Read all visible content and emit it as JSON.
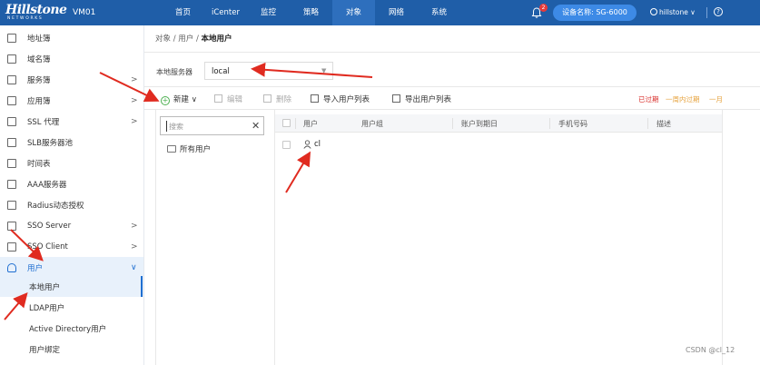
{
  "topbar": {
    "brand": "Hillstone",
    "brand_sub": "NETWORKS",
    "device": "VM01",
    "nav": [
      "首页",
      "iCenter",
      "监控",
      "策略",
      "对象",
      "网络",
      "系统"
    ],
    "active_nav": "对象",
    "notification_count": "2",
    "device_name_btn": "设备名称: SG-6000",
    "user": "hillstone",
    "user_caret": "∨",
    "help": "?"
  },
  "sidebar": {
    "items": [
      {
        "label": "地址簿",
        "chevron": ""
      },
      {
        "label": "域名簿",
        "chevron": ""
      },
      {
        "label": "服务簿",
        "chevron": ">"
      },
      {
        "label": "应用簿",
        "chevron": ">"
      },
      {
        "label": "SSL 代理",
        "chevron": ">"
      },
      {
        "label": "SLB服务器池",
        "chevron": ""
      },
      {
        "label": "时间表",
        "chevron": ""
      },
      {
        "label": "AAA服务器",
        "chevron": ""
      },
      {
        "label": "Radius动态授权",
        "chevron": ""
      },
      {
        "label": "SSO Server",
        "chevron": ">"
      },
      {
        "label": "SSO Client",
        "chevron": ">"
      },
      {
        "label": "用户",
        "chevron": "∨"
      }
    ],
    "sub_items": [
      "本地用户",
      "LDAP用户",
      "Active Directory用户",
      "用户绑定"
    ]
  },
  "breadcrumb": {
    "path": "对象 / 用户 / ",
    "current": "本地用户"
  },
  "server": {
    "label": "本地服务器",
    "value": "local",
    "caret": "▼"
  },
  "toolbar": {
    "new": "新建",
    "new_caret": "∨",
    "edit": "编辑",
    "delete": "删除",
    "import": "导入用户列表",
    "export": "导出用户列表",
    "expired": "已过期",
    "expire_week": "一周内过期",
    "expire_month": "一月"
  },
  "tree": {
    "search_placeholder": "搜索",
    "clear": "✕",
    "root": "所有用户"
  },
  "table": {
    "columns": [
      "用户",
      "用户组",
      "账户到期日",
      "手机号码",
      "描述"
    ],
    "rows": [
      {
        "user": "cl"
      }
    ]
  },
  "watermark": "CSDN @cl_12",
  "colors": {
    "topbar": "#1f5ea8",
    "active": "#1f6fd1",
    "arrow": "#e02b20"
  }
}
